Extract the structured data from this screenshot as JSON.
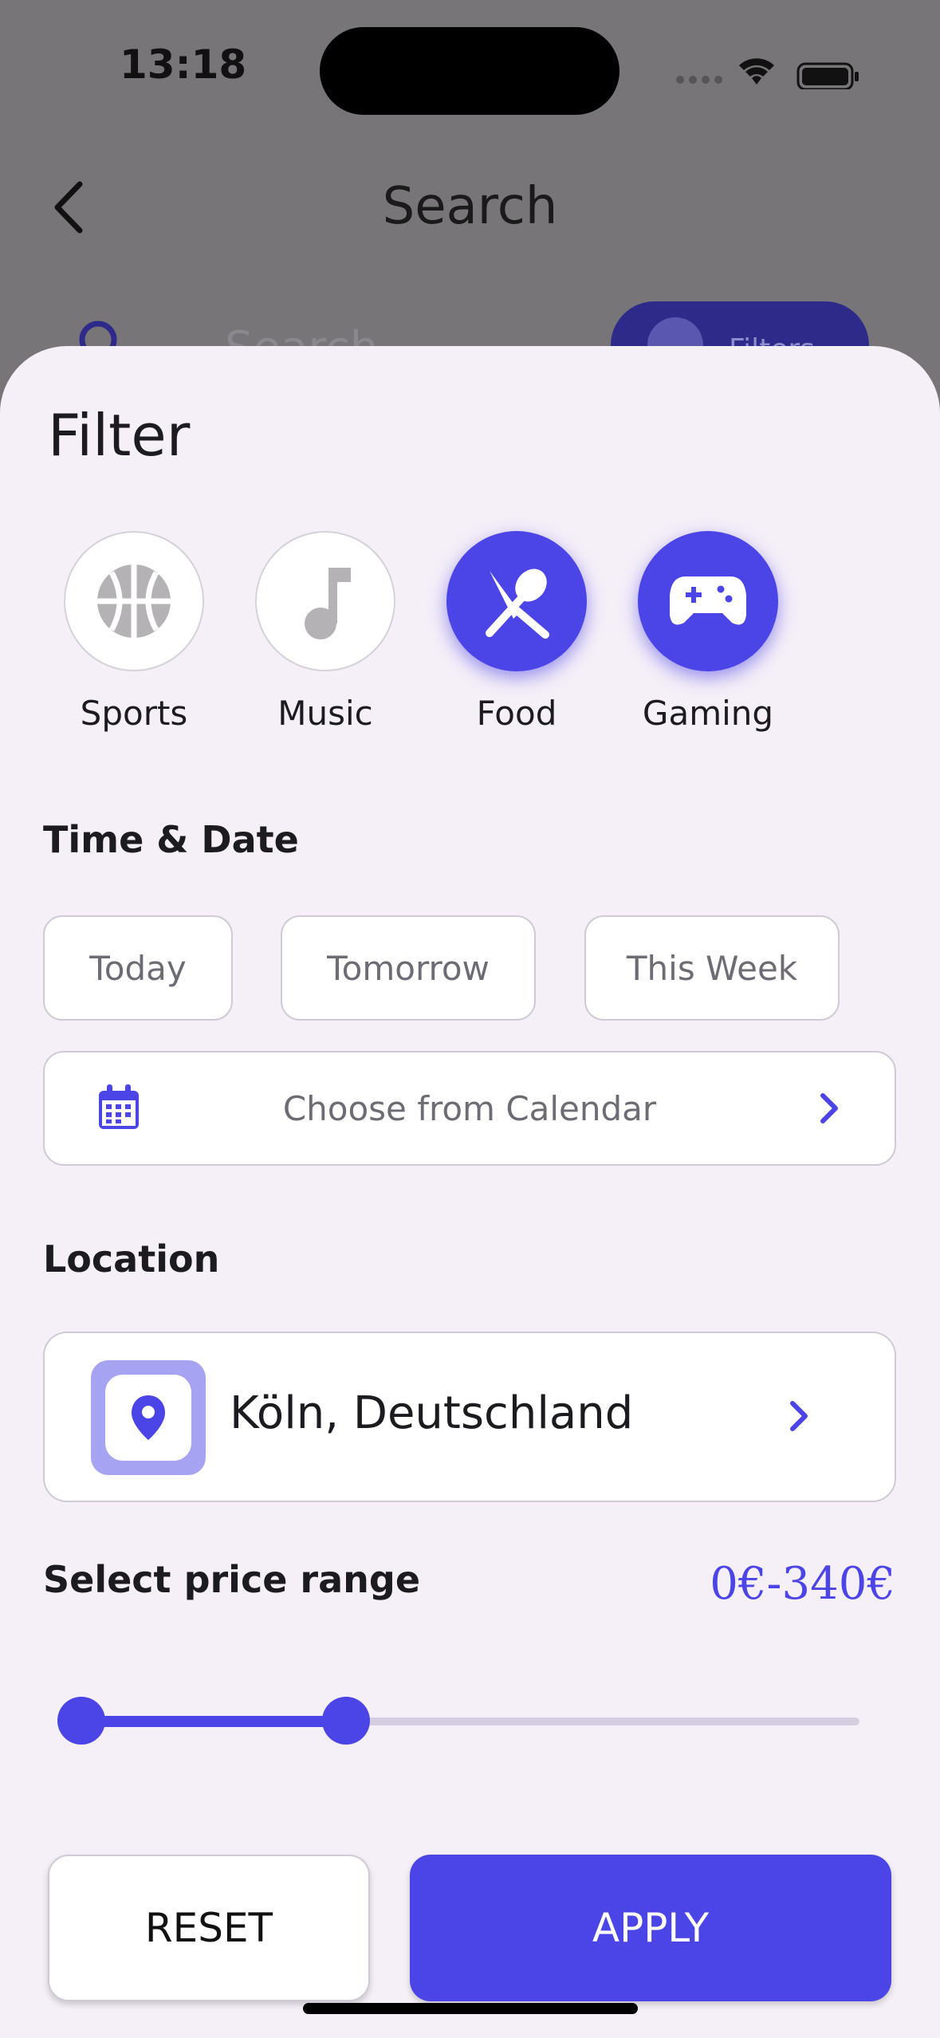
{
  "status_bar": {
    "time": "13:18"
  },
  "background_page": {
    "title": "Search",
    "search_placeholder": "Search",
    "filters_button": "Filters"
  },
  "sheet": {
    "title": "Filter",
    "categories": [
      {
        "label": "Sports",
        "icon": "basketball-icon",
        "selected": false
      },
      {
        "label": "Music",
        "icon": "music-note-icon",
        "selected": false
      },
      {
        "label": "Food",
        "icon": "utensils-icon",
        "selected": true
      },
      {
        "label": "Gaming",
        "icon": "gamepad-icon",
        "selected": true
      }
    ],
    "time_date": {
      "title": "Time & Date",
      "chips": [
        "Today",
        "Tomorrow",
        "This Week"
      ],
      "calendar_label": "Choose from Calendar"
    },
    "location": {
      "title": "Location",
      "value": "Köln, Deutschland"
    },
    "price": {
      "title": "Select price range",
      "value": "0€-340€",
      "range_fraction": [
        0.0,
        0.34
      ]
    },
    "buttons": {
      "reset": "RESET",
      "apply": "APPLY"
    }
  },
  "colors": {
    "accent": "#4b44e6",
    "sheet_bg": "#f5eff8",
    "overlay": "#777577",
    "muted_icon": "#b4b2b4"
  }
}
